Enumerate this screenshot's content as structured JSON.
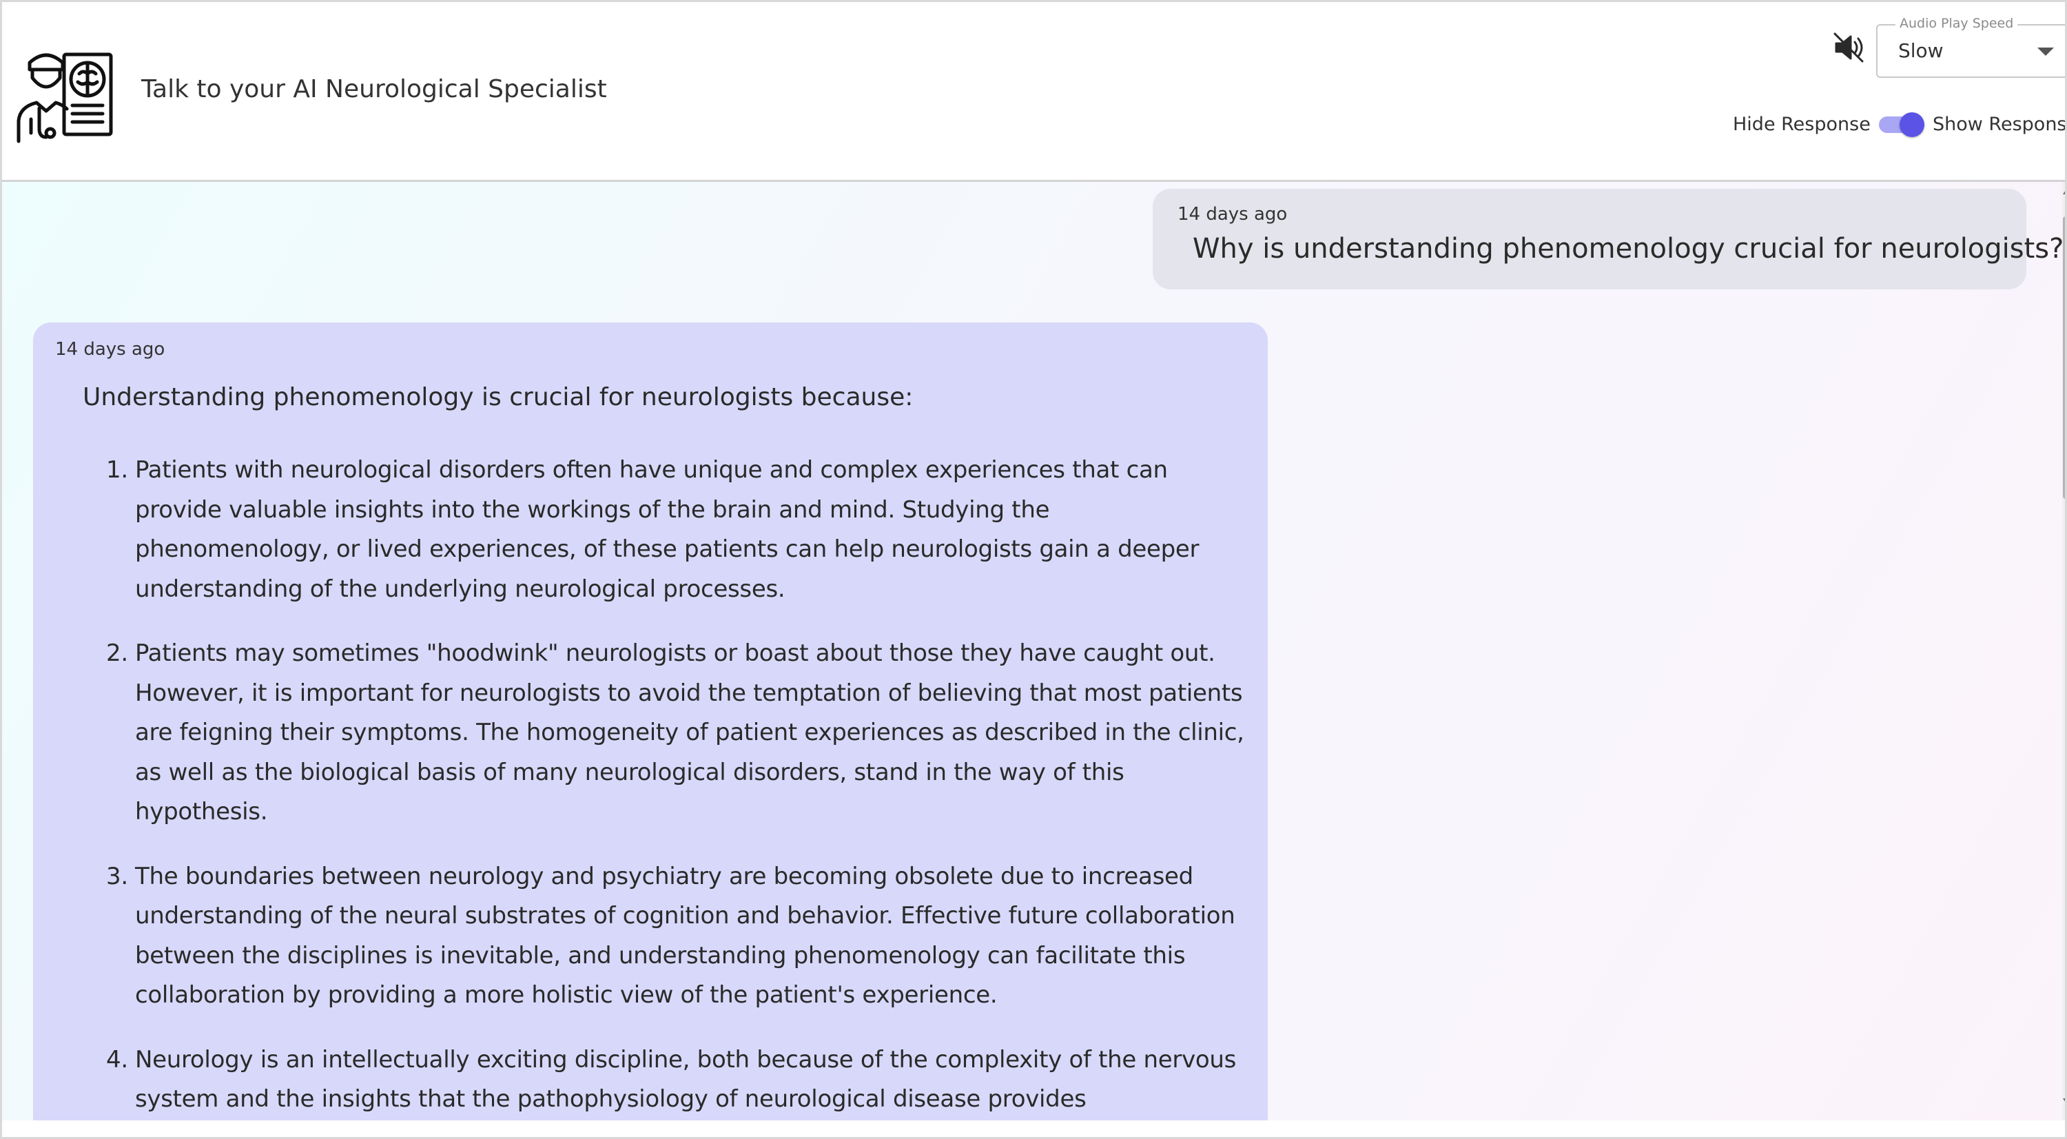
{
  "header": {
    "title": "Talk to your AI Neurological Specialist",
    "logo_icon": "doctor-brain-scan-icon",
    "mute_icon": "speaker-muted-icon",
    "audio_speed": {
      "legend": "Audio Play Speed",
      "value": "Slow"
    },
    "response_toggle": {
      "off_label": "Hide Response",
      "on_label": "Show Response",
      "state": "on"
    }
  },
  "messages": {
    "user": {
      "time": "14 days ago",
      "text": "Why is understanding phenomenology crucial for neurologists?"
    },
    "ai": {
      "time": "14 days ago",
      "intro": "Understanding phenomenology is crucial for neurologists because:",
      "items": [
        {
          "num": "1.",
          "text": "Patients with neurological disorders often have unique and complex experiences that can provide valuable insights into the workings of the brain and mind. Studying the phenomenology, or lived experiences, of these patients can help neurologists gain a deeper understanding of the underlying neurological processes."
        },
        {
          "num": "2.",
          "text": "Patients may sometimes \"hoodwink\" neurologists or boast about those they have caught out. However, it is important for neurologists to avoid the temptation of believing that most patients are feigning their symptoms. The homogeneity of patient experiences as described in the clinic, as well as the biological basis of many neurological disorders, stand in the way of this hypothesis."
        },
        {
          "num": "3.",
          "text": "The boundaries between neurology and psychiatry are becoming obsolete due to increased understanding of the neural substrates of cognition and behavior. Effective future collaboration between the disciplines is inevitable, and understanding phenomenology can facilitate this collaboration by providing a more holistic view of the patient's experience."
        },
        {
          "num": "4.",
          "text": "Neurology is an intellectually exciting discipline, both because of the complexity of the nervous system and the insights that the pathophysiology of neurological disease provides"
        }
      ]
    }
  },
  "colors": {
    "accent": "#5a53e6",
    "ai_bubble": "#d8d8fa",
    "user_bubble": "#e4e4ec"
  }
}
